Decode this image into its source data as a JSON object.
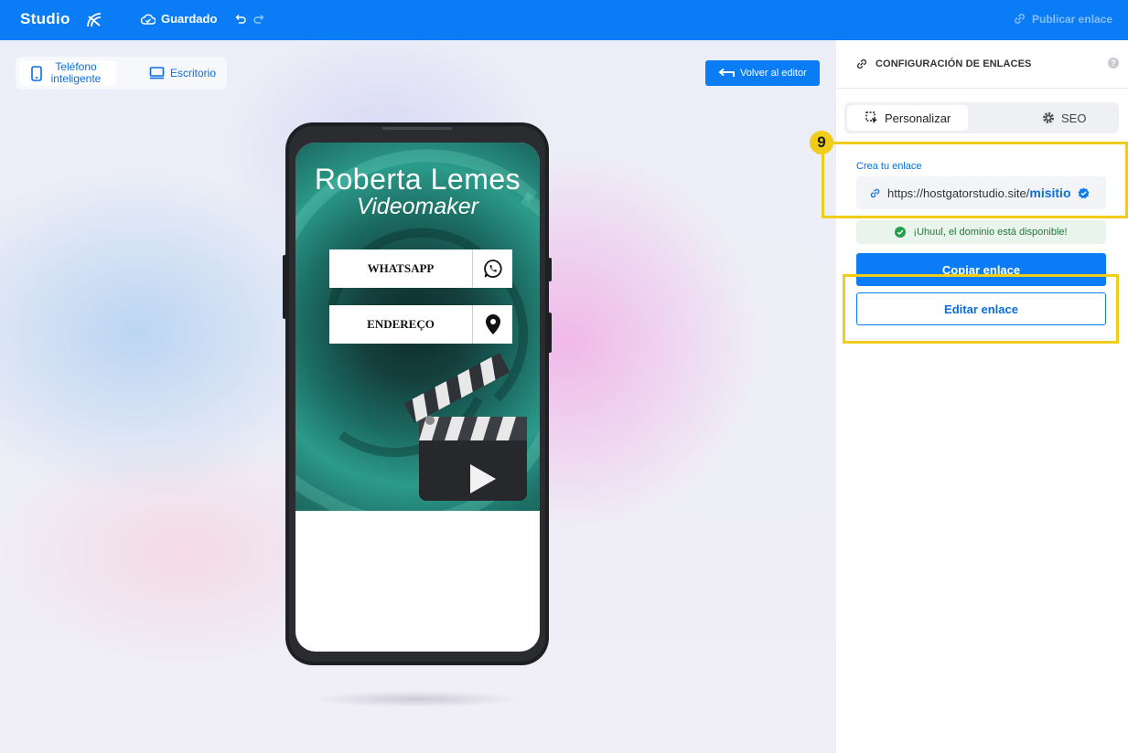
{
  "topbar": {
    "brand": "Studio",
    "saved_label": "Guardado",
    "publish_label": "Publicar enlace"
  },
  "canvas": {
    "device_smartphone": "Teléfono inteligente",
    "device_desktop": "Escritorio",
    "back_label": "Volver al editor"
  },
  "preview": {
    "name": "Roberta Lemes",
    "role": "Videomaker",
    "buttons": [
      {
        "label": "WHATSAPP",
        "icon": "whatsapp-icon"
      },
      {
        "label": "ENDEREÇO",
        "icon": "map-pin-icon"
      }
    ]
  },
  "panel": {
    "title": "CONFIGURACIÓN DE ENLACES",
    "help": "?",
    "tabs": [
      {
        "label": "Personalizar",
        "active": true
      },
      {
        "label": "SEO",
        "active": false
      }
    ],
    "create_label": "Crea tu enlace",
    "url_base": "https://hostgatorstudio.site/",
    "url_slug": "misitio",
    "availability": "¡Uhuul, el dominio está disponible!",
    "copy_label": "Copiar enlace",
    "edit_label": "Editar enlace"
  },
  "annotation": {
    "step": "9",
    "color": "#f0cd18"
  },
  "colors": {
    "primary": "#0a7cf5",
    "success": "#1f7a3c"
  }
}
